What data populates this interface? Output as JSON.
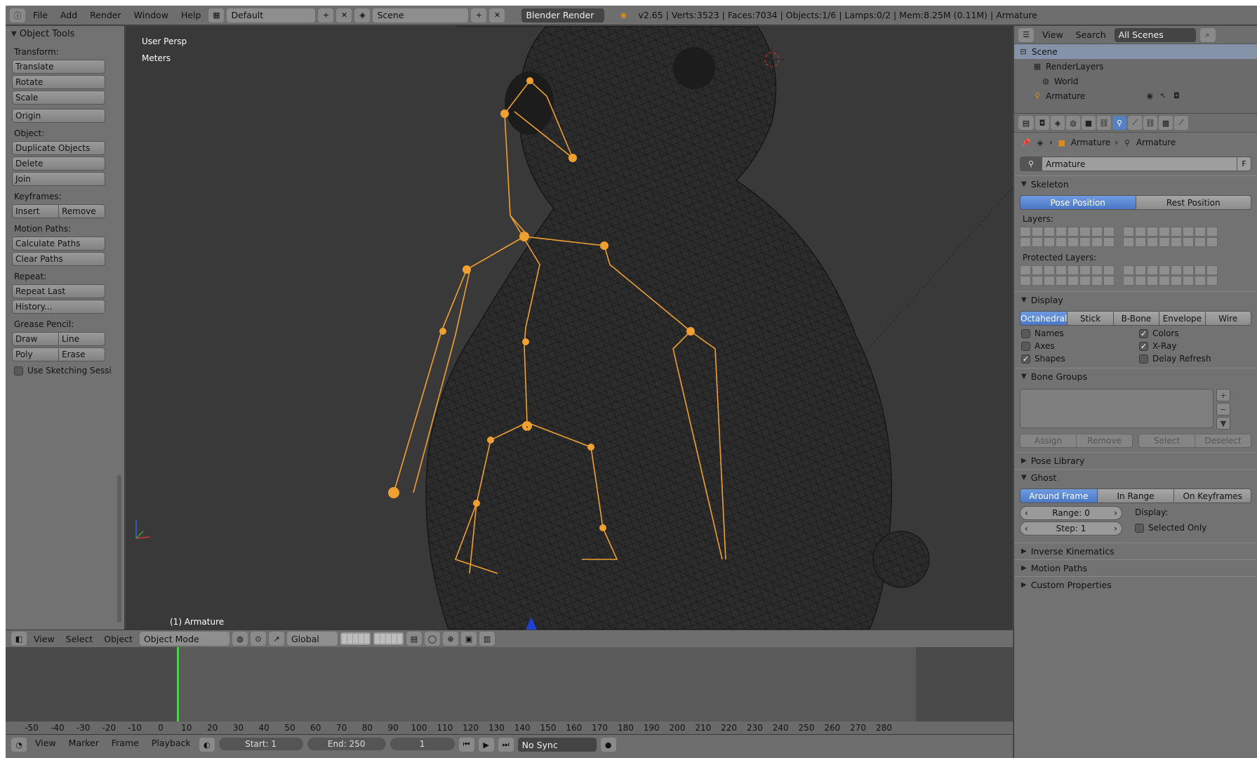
{
  "topbar": {
    "menu": [
      "File",
      "Add",
      "Render",
      "Window",
      "Help"
    ],
    "screen_layout": "Default",
    "scene": "Scene",
    "render_engine": "Blender Render",
    "stats": "v2.65 | Verts:3523 | Faces:7034 | Objects:1/6 | Lamps:0/2 | Mem:8.25M (0.11M) | Armature"
  },
  "tools": {
    "title": "Object Tools",
    "transform_label": "Transform:",
    "translate": "Translate",
    "rotate": "Rotate",
    "scale": "Scale",
    "origin": "Origin",
    "object_label": "Object:",
    "duplicate": "Duplicate Objects",
    "delete": "Delete",
    "join": "Join",
    "keyframes_label": "Keyframes:",
    "insert": "Insert",
    "remove": "Remove",
    "motion_paths_label": "Motion Paths:",
    "calc_paths": "Calculate Paths",
    "clear_paths": "Clear Paths",
    "repeat_label": "Repeat:",
    "repeat_last": "Repeat Last",
    "history": "History...",
    "grease_label": "Grease Pencil:",
    "draw": "Draw",
    "line": "Line",
    "poly": "Poly",
    "erase": "Erase",
    "sketching": "Use Sketching Sessi"
  },
  "viewport": {
    "view_name": "User Persp",
    "units": "Meters",
    "active_object": "(1) Armature"
  },
  "view3d_header": {
    "view": "View",
    "select": "Select",
    "object": "Object",
    "mode": "Object Mode",
    "orientation": "Global"
  },
  "timeline": {
    "ticks": [
      "-50",
      "-40",
      "-30",
      "-20",
      "-10",
      "0",
      "10",
      "20",
      "30",
      "40",
      "50",
      "60",
      "70",
      "80",
      "90",
      "100",
      "110",
      "120",
      "130",
      "140",
      "150",
      "160",
      "170",
      "180",
      "190",
      "200",
      "210",
      "220",
      "230",
      "240",
      "250",
      "260",
      "270",
      "280"
    ],
    "current_frame": 0
  },
  "bottombar": {
    "view": "View",
    "marker": "Marker",
    "frame": "Frame",
    "playback": "Playback",
    "start": "Start: 1",
    "end": "End: 250",
    "current": "1",
    "sync": "No Sync"
  },
  "outliner": {
    "view": "View",
    "search": "Search",
    "filter": "All Scenes",
    "rows": [
      "Scene",
      "RenderLayers",
      "World",
      "Armature"
    ]
  },
  "props": {
    "crumb_object": "Armature",
    "crumb_data": "Armature",
    "datablock_name": "Armature",
    "datablock_flag": "F",
    "skeleton": "Skeleton",
    "pose_position": "Pose Position",
    "rest_position": "Rest Position",
    "layers": "Layers:",
    "protected_layers": "Protected Layers:",
    "display": "Display",
    "display_modes": [
      "Octahedral",
      "Stick",
      "B-Bone",
      "Envelope",
      "Wire"
    ],
    "names": "Names",
    "colors": "Colors",
    "axes": "Axes",
    "xray": "X-Ray",
    "shapes": "Shapes",
    "delay_refresh": "Delay Refresh",
    "bone_groups": "Bone Groups",
    "assign": "Assign",
    "remove": "Remove",
    "select": "Select",
    "deselect": "Deselect",
    "pose_library": "Pose Library",
    "ghost": "Ghost",
    "ghost_modes": [
      "Around Frame",
      "In Range",
      "On Keyframes"
    ],
    "range": "Range: 0",
    "step": "Step: 1",
    "display_label": "Display:",
    "selected_only": "Selected Only",
    "inverse_kinematics": "Inverse Kinematics",
    "motion_paths": "Motion Paths",
    "custom_properties": "Custom Properties"
  }
}
